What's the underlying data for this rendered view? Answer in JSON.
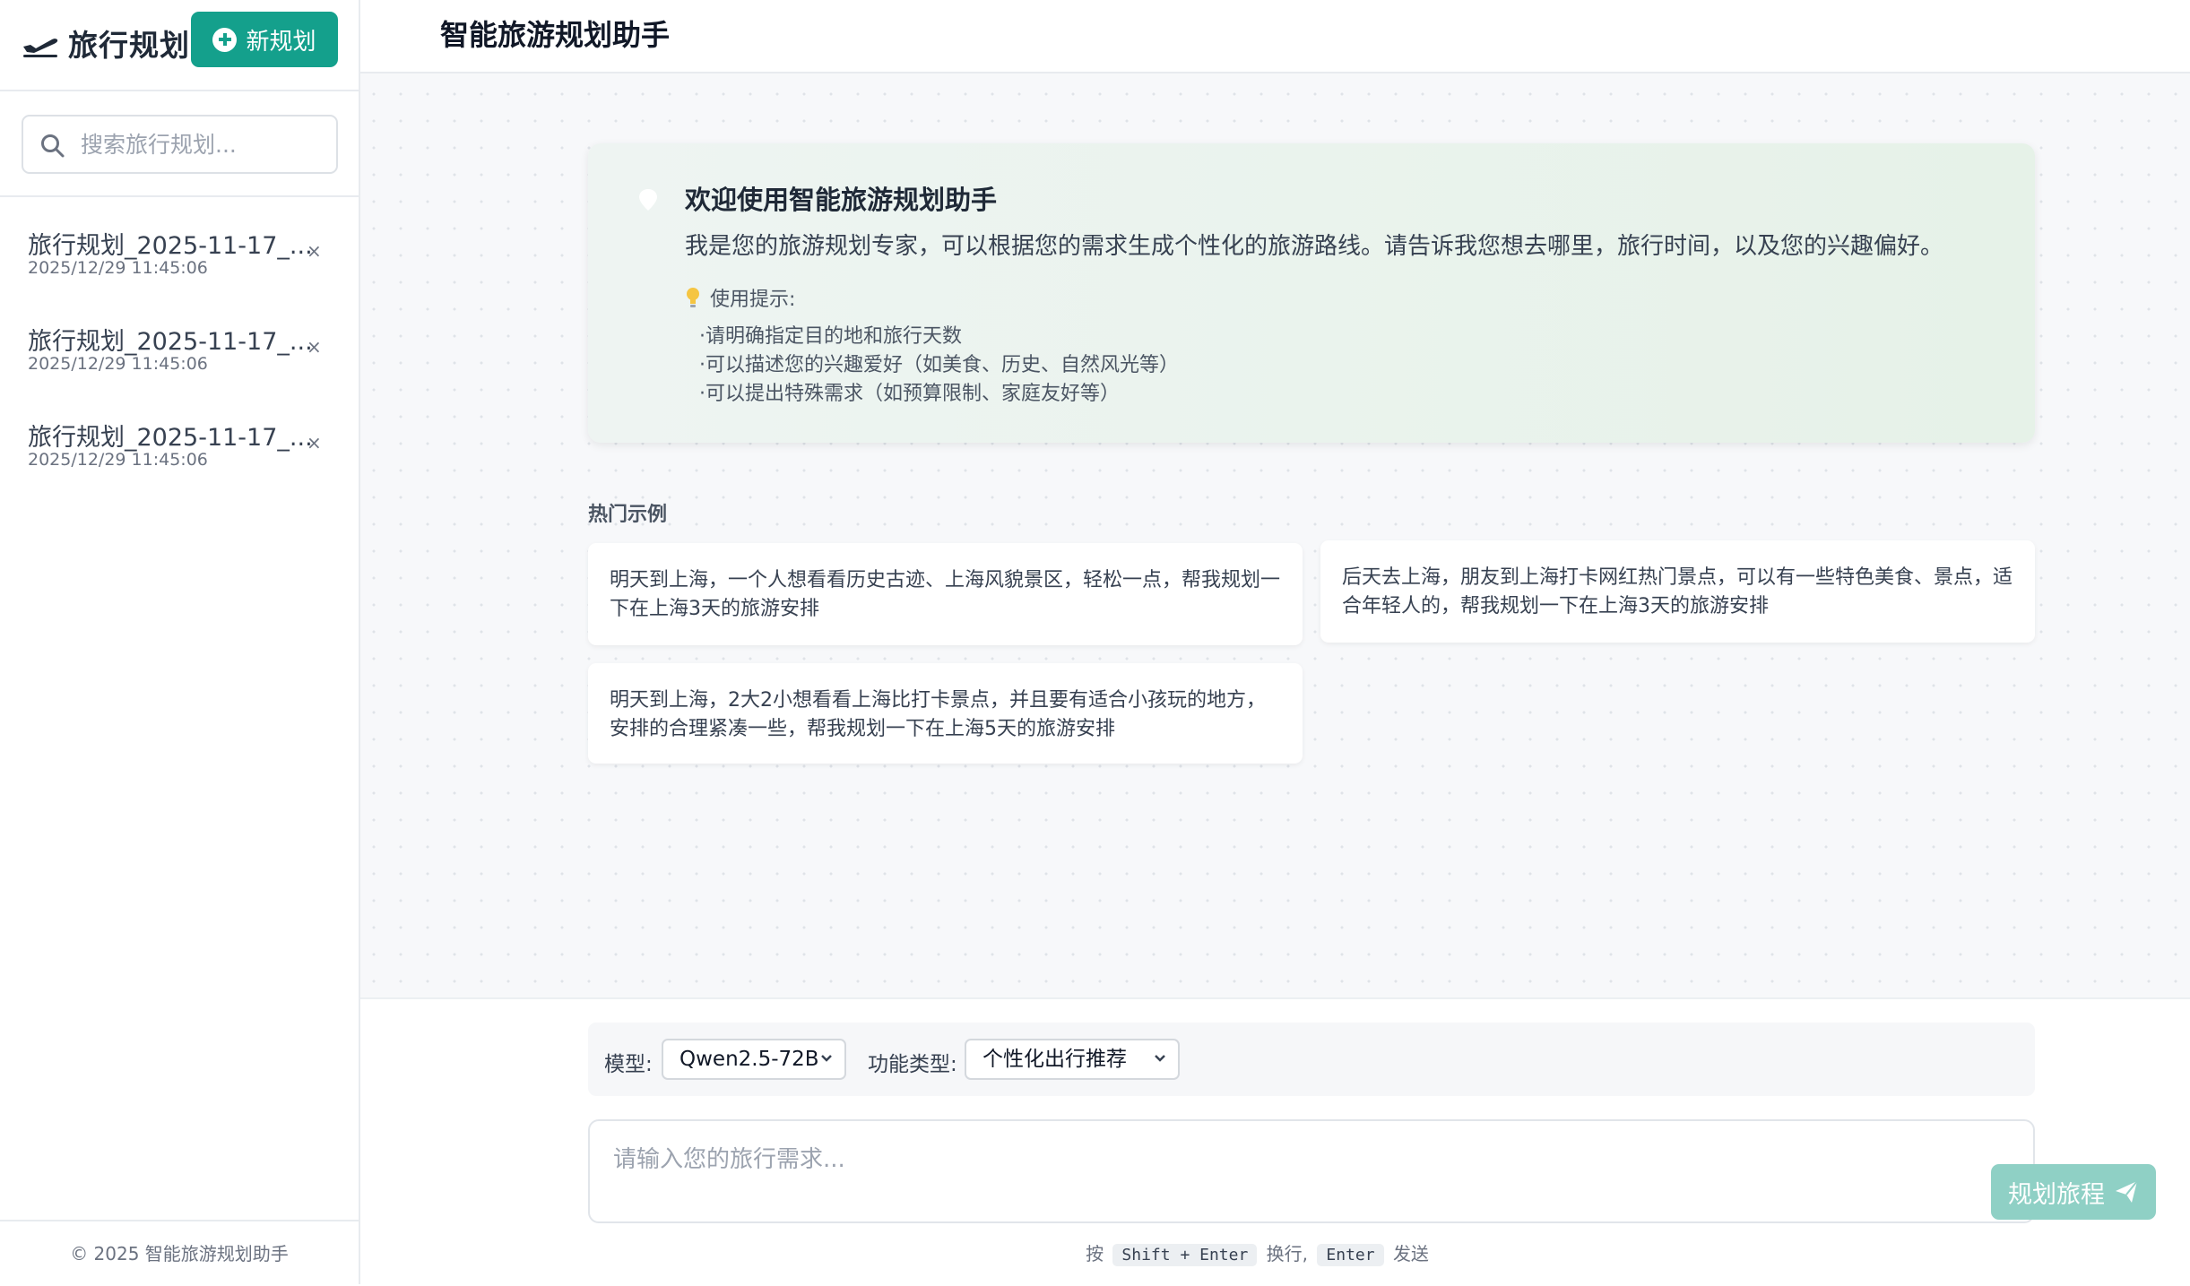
{
  "sidebar": {
    "app_name": "旅行规划",
    "new_button_label": "新规划",
    "search_placeholder": "搜索旅行规划...",
    "history": [
      {
        "title": "旅行规划_2025-11-17_...",
        "time": "2025/12/29 11:45:06",
        "close": "×"
      },
      {
        "title": "旅行规划_2025-11-17_...",
        "time": "2025/12/29 11:45:06",
        "close": "×"
      },
      {
        "title": "旅行规划_2025-11-17_...",
        "time": "2025/12/29 11:45:06",
        "close": "×"
      }
    ],
    "footer": "© 2025 智能旅游规划助手"
  },
  "header": {
    "title": "智能旅游规划助手"
  },
  "welcome": {
    "title": "欢迎使用智能旅游规划助手",
    "description": "我是您的旅游规划专家，可以根据您的需求生成个性化的旅游路线。请告诉我您想去哪里，旅行时间，以及您的兴趣偏好。",
    "tips_heading": "使用提示:",
    "tips": [
      "·请明确指定目的地和旅行天数",
      "·可以描述您的兴趣爱好（如美食、历史、自然风光等）",
      "·可以提出特殊需求（如预算限制、家庭友好等）"
    ]
  },
  "examples": {
    "label": "热门示例",
    "items": [
      "明天到上海，一个人想看看历史古迹、上海风貌景区，轻松一点，帮我规划一下在上海3天的旅游安排",
      "后天去上海，朋友到上海打卡网红热门景点，可以有一些特色美食、景点，适合年轻人的，帮我规划一下在上海3天的旅游安排",
      "明天到上海，2大2小想看看上海比打卡景点，并且要有适合小孩玩的地方，安排的合理紧凑一些，帮我规划一下在上海5天的旅游安排"
    ]
  },
  "composer": {
    "model_label": "模型:",
    "model_value": "Qwen2.5-72B",
    "feature_label": "功能类型:",
    "feature_value": "个性化出行推荐",
    "input_placeholder": "请输入您的旅行需求...",
    "send_label": "规划旅程",
    "hint_prefix": "按",
    "hint_key1": "Shift + Enter",
    "hint_mid": "换行,",
    "hint_key2": "Enter",
    "hint_suffix": "发送"
  },
  "colors": {
    "accent": "#14a08c",
    "send_disabled": "#8fd0c5"
  },
  "icons": {
    "logo": "plane-icon",
    "new": "plus-circle-icon",
    "search": "search-icon",
    "send": "paper-plane-icon",
    "tips": "lightbulb-icon"
  }
}
